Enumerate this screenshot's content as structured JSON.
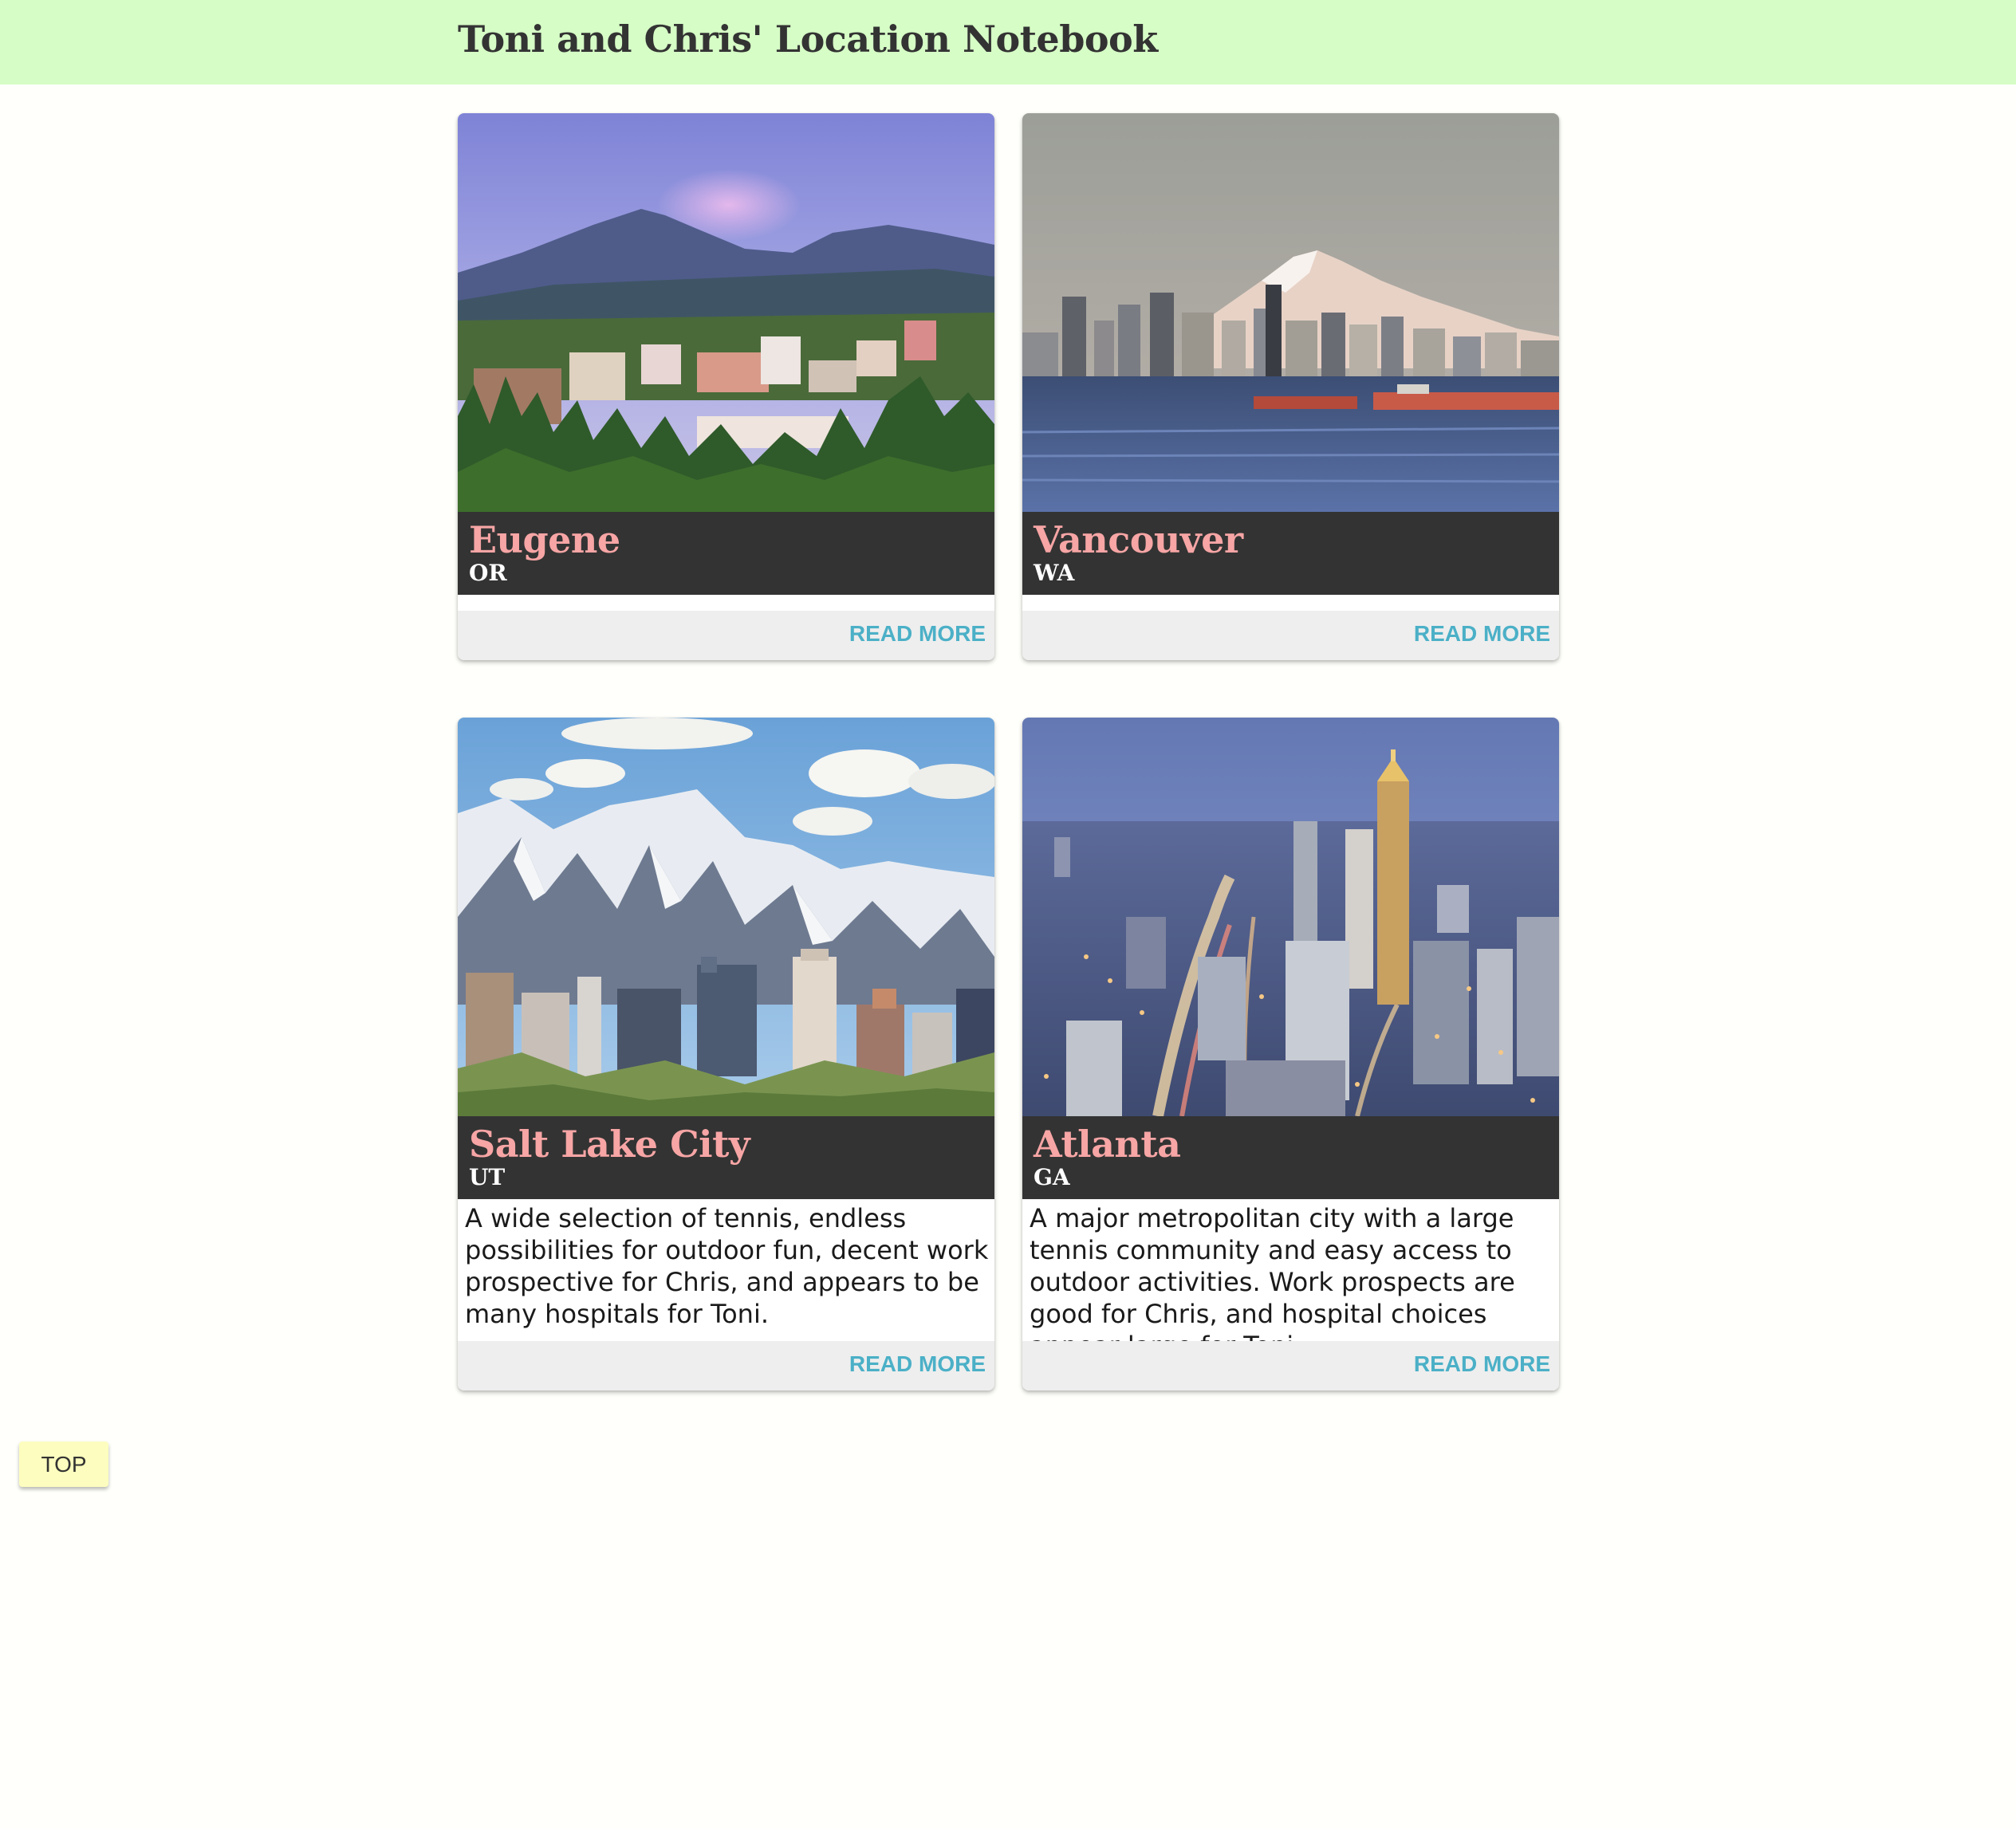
{
  "header": {
    "title": "Toni and Chris' Location Notebook"
  },
  "cards": [
    {
      "city": "Eugene",
      "state": "OR",
      "description": "",
      "read_more": "READ MORE",
      "image": "eugene-mountain-town-photo"
    },
    {
      "city": "Vancouver",
      "state": "WA",
      "description": "",
      "read_more": "READ MORE",
      "image": "vancouver-skyline-mount-baker-photo"
    },
    {
      "city": "Salt Lake City",
      "state": "UT",
      "description": "A wide selection of tennis, endless possibilities for outdoor fun, decent work prospective for Chris, and appears to be many hospitals for Toni.",
      "read_more": "READ MORE",
      "image": "salt-lake-city-snowy-mountains-photo"
    },
    {
      "city": "Atlanta",
      "state": "GA",
      "description": "A major metropolitan city with a large tennis community and easy access to outdoor activities. Work prospects are good for Chris, and hospital choices appear large for Toni",
      "read_more": "READ MORE",
      "image": "atlanta-skyline-dusk-photo"
    }
  ],
  "top_button": {
    "label": "TOP"
  },
  "colors": {
    "header_bg": "#d6fdc6",
    "title_bar": "#333333",
    "city_name": "#f7a5a5",
    "read_more": "#4bb0c7",
    "footer_bg": "#eeeeee",
    "top_button_bg": "#fdfdbf"
  }
}
